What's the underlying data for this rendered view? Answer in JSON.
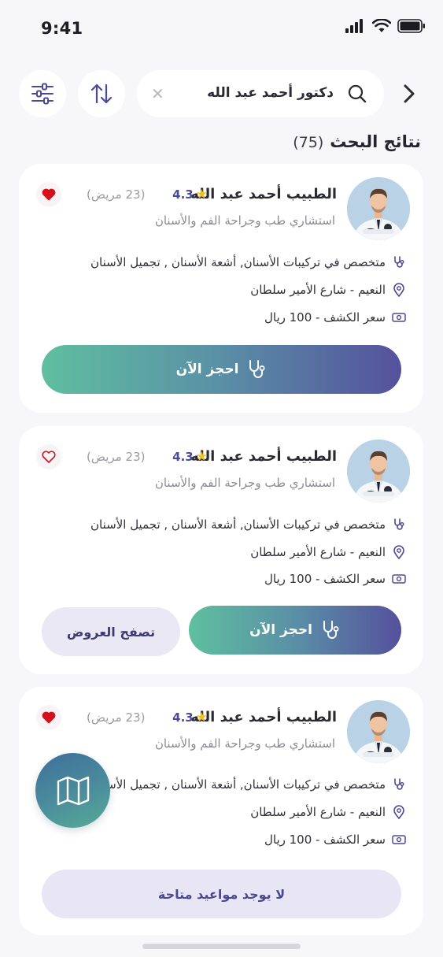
{
  "status": {
    "time": "9:41"
  },
  "search": {
    "query": "دكتور أحمد عبد الله",
    "clear_symbol": "✕"
  },
  "results": {
    "title": "نتائج البحث",
    "count": "(75)"
  },
  "doctors": [
    {
      "name": "الطبيب أحمد عبد الله",
      "rating": "4.3",
      "patients": "(23 مريض)",
      "specialty": "استشاري طب وجراحة الفم والأسنان",
      "services": "متخصص في تركيبات الأسنان, أشعة الأسنان , تجميل الأسنان",
      "location": "النعيم - شارع الأمير سلطان",
      "price": "سعر الكشف - 100 ريال",
      "favorite": true,
      "book_label": "احجز الآن"
    },
    {
      "name": "الطبيب أحمد عبد الله",
      "rating": "4.3",
      "patients": "(23 مريض)",
      "specialty": "استشاري طب وجراحة الفم والأسنان",
      "services": "متخصص في تركيبات الأسنان, أشعة الأسنان , تجميل الأسنان",
      "location": "النعيم - شارع الأمير سلطان",
      "price": "سعر الكشف - 100 ريال",
      "favorite": false,
      "book_label": "احجز الآن",
      "offers_label": "تصفح العروض"
    },
    {
      "name": "الطبيب أحمد عبد الله",
      "rating": "4.3",
      "patients": "(23 مريض)",
      "specialty": "استشاري طب وجراحة الفم والأسنان",
      "services": "متخصص في تركيبات الأسنان, أشعة الأسنان , تجميل الأسنان",
      "location": "النعيم - شارع الأمير سلطان",
      "price": "سعر الكشف - 100 ريال",
      "favorite": true,
      "unavailable_label": "لا يوجد مواعيد متاحة"
    }
  ],
  "icons": {
    "search": "search-icon",
    "filter": "sliders-icon",
    "sort": "sort-arrows-icon",
    "back": "chevron-right-icon",
    "map": "map-icon",
    "heart": "heart-icon",
    "star": "star-icon",
    "stethoscope": "stethoscope-icon",
    "location": "location-pin-icon",
    "money": "cash-icon"
  },
  "colors": {
    "accent_purple": "#4b4a99",
    "accent_green": "#5fbf9f",
    "heart_red": "#d3121e",
    "star": "#f4c21c",
    "background": "#f7f7f9"
  }
}
